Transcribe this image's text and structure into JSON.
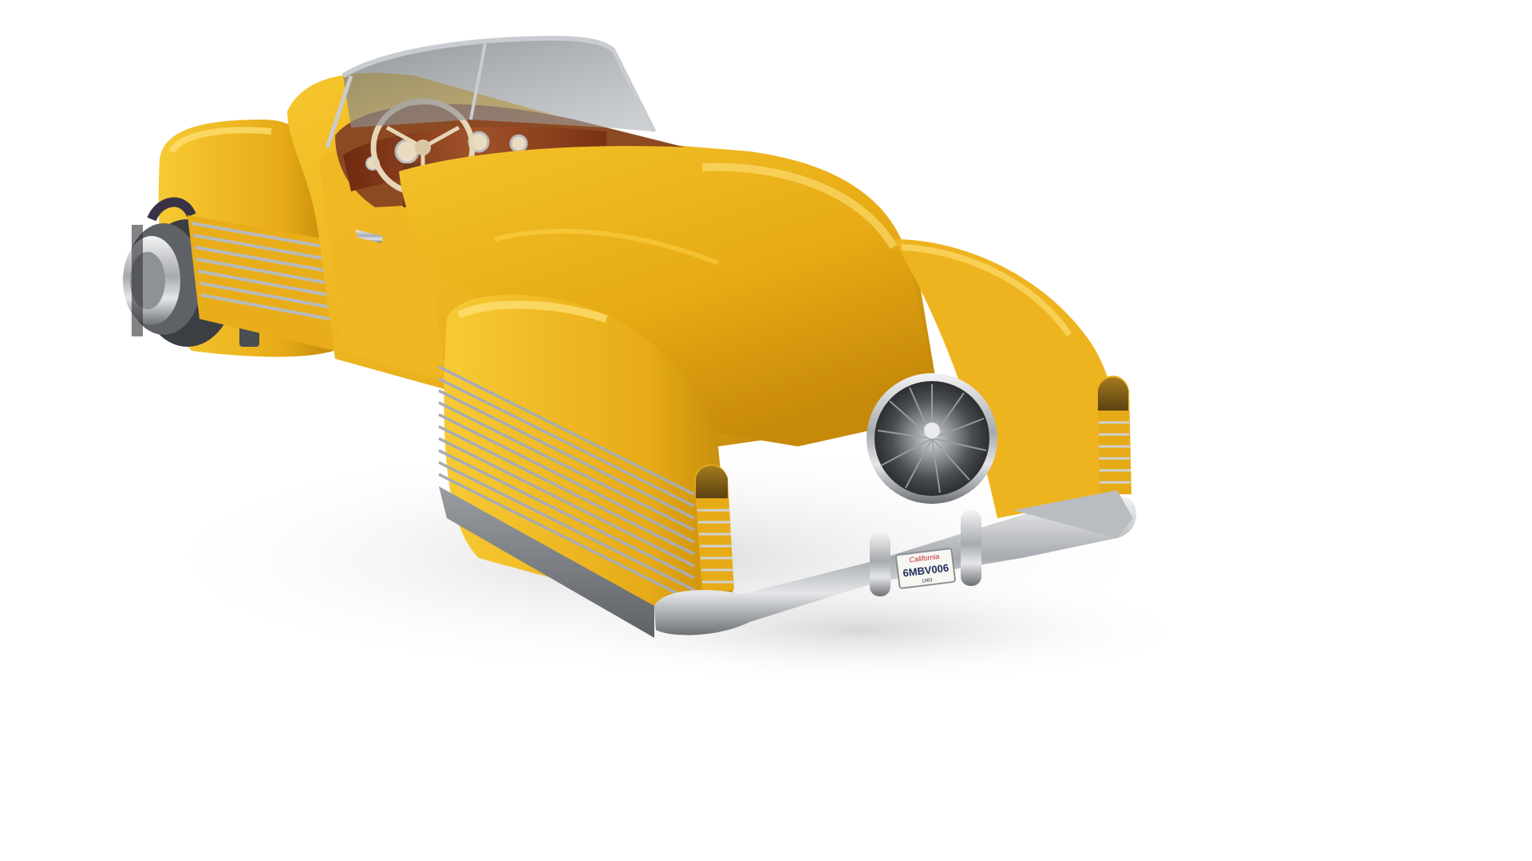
{
  "scene": {
    "subject": "yellow retro-futuristic hover roadster",
    "background_color": "#ffffff",
    "colors": {
      "body_main": "#eab420",
      "body_highlight": "#ffd84a",
      "body_shadow": "#b57a06",
      "chrome": "#c9ccd0",
      "chrome_dark": "#6d7075",
      "glass": "#8c9095",
      "wood": "#8a3a1a",
      "interior": "#c9b89a",
      "lamp_amber": "#8a6a1c"
    }
  },
  "license_plate": {
    "state": "California",
    "number": "6MBV006",
    "year": "1983"
  }
}
